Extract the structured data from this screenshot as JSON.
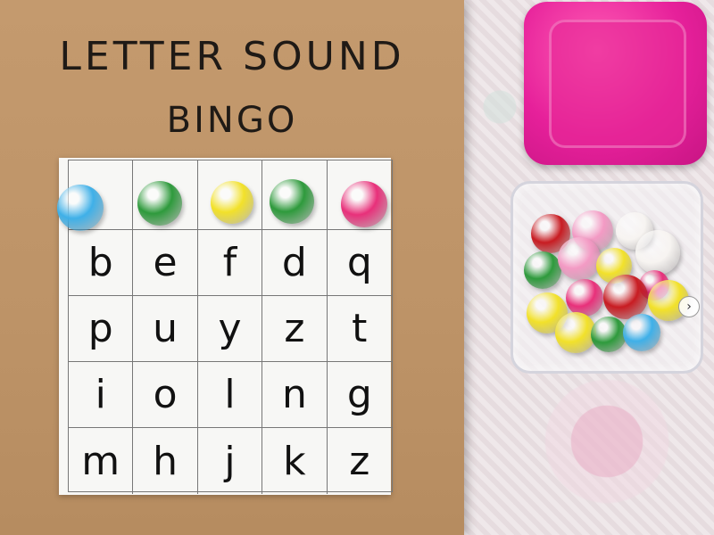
{
  "title": {
    "line1": "LETTER SOUND",
    "line2": "BINGO"
  },
  "bingo_grid": {
    "rows": [
      [
        "b",
        "e",
        "f",
        "d",
        "q"
      ],
      [
        "p",
        "u",
        "y",
        "z",
        "t"
      ],
      [
        "i",
        "o",
        "l",
        "n",
        "g"
      ],
      [
        "m",
        "h",
        "j",
        "k",
        "z"
      ]
    ]
  },
  "header_pompoms": [
    "blue",
    "green",
    "yellow",
    "green",
    "pink"
  ],
  "colors": {
    "blue": "#3fb0e8",
    "green": "#2e9a3c",
    "yellow": "#f2e12a",
    "pink": "#e8307a",
    "red": "#c81c22",
    "light_pink": "#f39ac4",
    "white": "#f7f4f1",
    "lid": "#e6209a"
  },
  "ui": {
    "next_icon": "›"
  }
}
